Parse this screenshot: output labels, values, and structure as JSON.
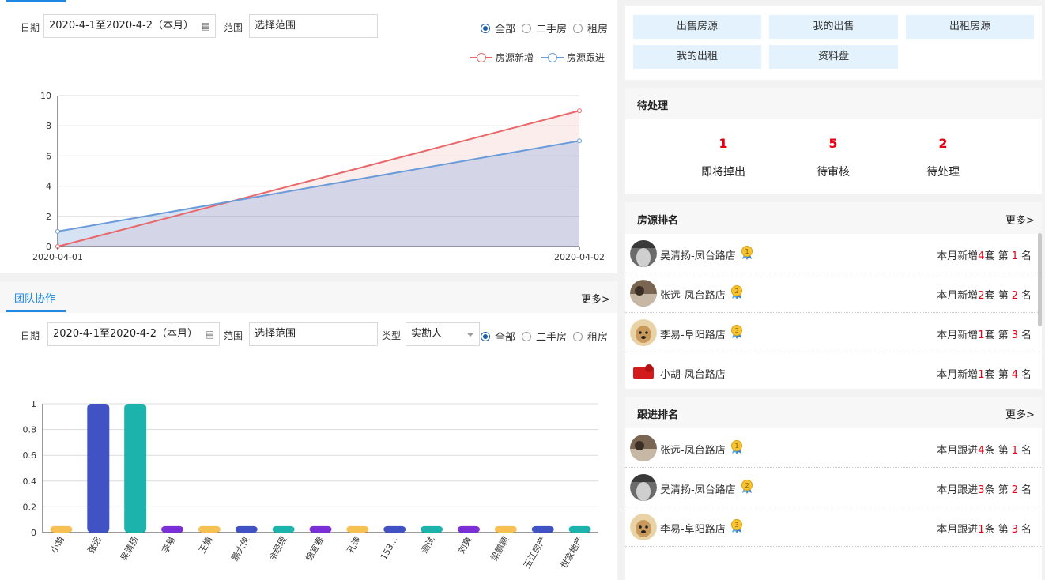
{
  "line_filters": {
    "date_label": "日期",
    "date_value": "2020-4-1至2020-4-2（本月）",
    "range_label": "范围",
    "range_placeholder": "选择范围",
    "radio": [
      "全部",
      "二手房",
      "租房"
    ],
    "radio_selected": 0
  },
  "team": {
    "tab_label": "团队协作",
    "more": "更多>",
    "date_label": "日期",
    "date_value": "2020-4-1至2020-4-2（本月）",
    "range_label": "范围",
    "range_placeholder": "选择范围",
    "type_label": "类型",
    "type_value": "实勘人",
    "radio": [
      "全部",
      "二手房",
      "租房"
    ],
    "radio_selected": 0
  },
  "quick_buttons": [
    "出售房源",
    "我的出售",
    "出租房源",
    "我的出租",
    "资料盘"
  ],
  "pending": {
    "title": "待处理",
    "items": [
      {
        "count": "1",
        "label": "即将掉出"
      },
      {
        "count": "5",
        "label": "待审核"
      },
      {
        "count": "2",
        "label": "待处理"
      }
    ]
  },
  "listing_rank": {
    "title": "房源排名",
    "more": "更多>",
    "rows": [
      {
        "name": "吴清扬-凤台路店",
        "medal": "1",
        "prefix": "本月新增",
        "count": "4",
        "unit": "套 第",
        "rank": "1",
        "suffix": "名",
        "avatar": "dark"
      },
      {
        "name": "张远-凤台路店",
        "medal": "2",
        "prefix": "本月新增",
        "count": "2",
        "unit": "套 第",
        "rank": "2",
        "suffix": "名",
        "avatar": "brown"
      },
      {
        "name": "李易-阜阳路店",
        "medal": "3",
        "prefix": "本月新增",
        "count": "1",
        "unit": "套 第",
        "rank": "3",
        "suffix": "名",
        "avatar": "dog"
      },
      {
        "name": "小胡-凤台路店",
        "medal": "",
        "prefix": "本月新增",
        "count": "1",
        "unit": "套 第",
        "rank": "4",
        "suffix": "名",
        "avatar": "red"
      }
    ]
  },
  "follow_rank": {
    "title": "跟进排名",
    "more": "更多>",
    "rows": [
      {
        "name": "张远-凤台路店",
        "medal": "1",
        "prefix": "本月跟进",
        "count": "4",
        "unit": "条 第",
        "rank": "1",
        "suffix": "名",
        "avatar": "brown"
      },
      {
        "name": "吴清扬-凤台路店",
        "medal": "2",
        "prefix": "本月跟进",
        "count": "3",
        "unit": "条 第",
        "rank": "2",
        "suffix": "名",
        "avatar": "dark"
      },
      {
        "name": "李易-阜阳路店",
        "medal": "3",
        "prefix": "本月跟进",
        "count": "1",
        "unit": "条 第",
        "rank": "3",
        "suffix": "名",
        "avatar": "dog"
      }
    ]
  },
  "colors": {
    "accent": "#1e88e5",
    "red_series": "#e8676b",
    "blue_series": "#6a9bd8",
    "bar_palette": [
      "#f6c052",
      "#4152c4",
      "#1db3ad",
      "#7b2fd6"
    ]
  },
  "chart_data": [
    {
      "type": "area",
      "x": [
        "2020-04-01",
        "2020-04-02"
      ],
      "ylim": [
        0,
        10
      ],
      "yticks": [
        0,
        2,
        4,
        6,
        8,
        10
      ],
      "series": [
        {
          "name": "房源新增",
          "values": [
            0,
            9
          ],
          "color": "#e8676b"
        },
        {
          "name": "房源跟进",
          "values": [
            1,
            7
          ],
          "color": "#6a9bd8"
        }
      ],
      "legend_position": "top-right",
      "grid": true
    },
    {
      "type": "bar",
      "categories": [
        "小胡",
        "张远",
        "吴清扬",
        "李易",
        "王娟",
        "鹏大侠",
        "余经理",
        "徐宜春",
        "孔涛",
        "153...",
        "测试",
        "刘爽",
        "梁鹏颖",
        "玉江房产",
        "世家地产"
      ],
      "values": [
        0.05,
        1,
        1,
        0.05,
        0.05,
        0.05,
        0.05,
        0.05,
        0.05,
        0.05,
        0.05,
        0.05,
        0.05,
        0.05,
        0.05
      ],
      "ylim": [
        0,
        1
      ],
      "yticks": [
        0,
        0.2,
        0.4,
        0.6,
        0.8,
        1
      ],
      "grid": true
    }
  ]
}
